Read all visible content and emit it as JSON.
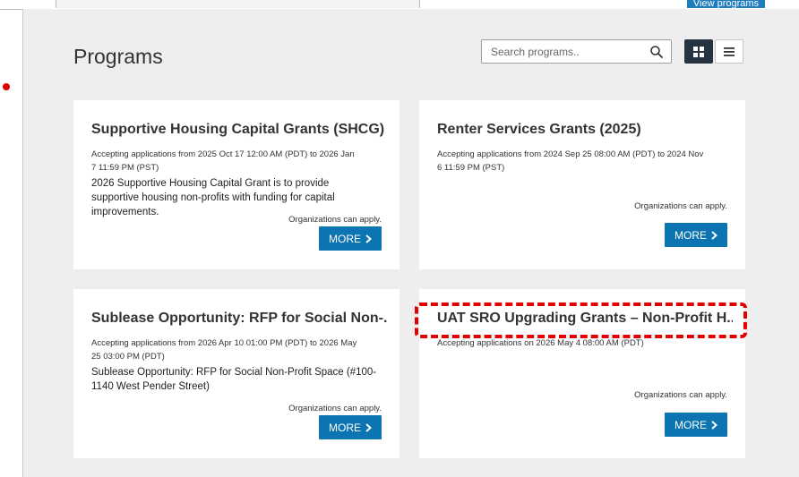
{
  "top_bar": {
    "button_label": "View programs"
  },
  "page": {
    "title": "Programs"
  },
  "search": {
    "placeholder": "Search programs.."
  },
  "view_toggle": {
    "grid_icon": "grid-icon",
    "list_icon": "list-icon",
    "selected": "grid"
  },
  "programs": [
    {
      "title": "Supportive Housing Capital Grants (SHCG)",
      "dates": "Accepting applications from 2025 Oct 17 12:00 AM (PDT) to 2026 Jan 7 11:59 PM (PST)",
      "description": "2026 Supportive Housing Capital Grant is to provide supportive housing non-profits with funding for capital improvements.",
      "eligibility": "Organizations can apply.",
      "more_label": "MORE"
    },
    {
      "title": "Renter Services Grants (2025)",
      "dates": "Accepting applications from 2024 Sep 25 08:00 AM (PDT) to 2024 Nov 6 11:59 PM (PST)",
      "description": "",
      "eligibility": "Organizations can apply.",
      "more_label": "MORE"
    },
    {
      "title": "Sublease Opportunity: RFP for Social Non-...",
      "dates": "Accepting applications from 2026 Apr 10 01:00 PM (PDT) to 2026 May 25 03:00 PM (PDT)",
      "description": "Sublease Opportunity: RFP for Social Non-Profit Space (#100-1140 West Pender Street)",
      "eligibility": "Organizations can apply.",
      "more_label": "MORE"
    },
    {
      "title": "UAT SRO Upgrading Grants – Non-Profit H...",
      "dates": "Accepting applications on 2026 May 4 08:00 AM (PDT)",
      "description": "",
      "eligibility": "Organizations can apply.",
      "more_label": "MORE"
    }
  ],
  "colors": {
    "accent": "#0c74b0",
    "highlight": "#e20000",
    "panel_bg": "#eeeeee"
  }
}
